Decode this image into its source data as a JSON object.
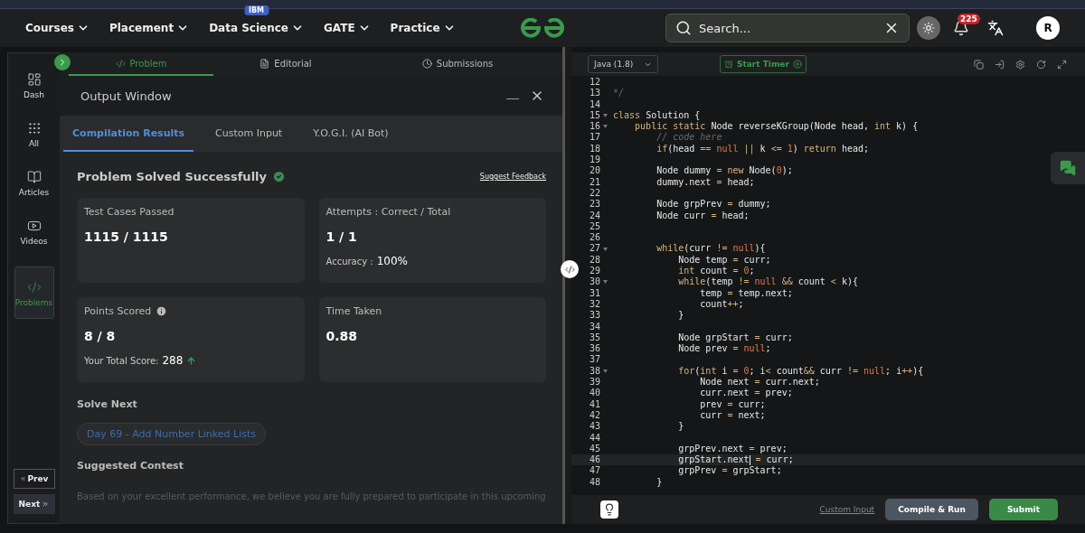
{
  "nav": {
    "items": [
      {
        "label": "Courses"
      },
      {
        "label": "Placement"
      },
      {
        "label": "Data Science",
        "badge": "IBM"
      },
      {
        "label": "GATE"
      },
      {
        "label": "Practice"
      }
    ],
    "search": {
      "placeholder": "Search..."
    },
    "notifications": "225",
    "avatar": "R"
  },
  "sidebar": {
    "items": [
      {
        "label": "Dash",
        "selected": false
      },
      {
        "label": "All",
        "selected": false
      },
      {
        "label": "Articles",
        "selected": false
      },
      {
        "label": "Videos",
        "selected": false
      },
      {
        "label": "Problems",
        "selected": true
      }
    ],
    "prev": "Prev",
    "next": "Next"
  },
  "problem_tabs": [
    {
      "label": "Problem",
      "selected": true
    },
    {
      "label": "Editorial",
      "selected": false
    },
    {
      "label": "Submissions",
      "selected": false
    }
  ],
  "output": {
    "title": "Output Window",
    "tabs": [
      {
        "label": "Compilation Results",
        "selected": true
      },
      {
        "label": "Custom Input",
        "selected": false
      },
      {
        "label": "Y.O.G.I. (AI Bot)",
        "selected": false
      }
    ],
    "status": "Problem Solved Successfully",
    "feedback": "Suggest Feedback",
    "cards": [
      {
        "label": "Test Cases Passed",
        "value": "1115 / 1115"
      },
      {
        "label": "Attempts : Correct / Total",
        "value": "1 / 1",
        "extra_label": "Accuracy :",
        "extra_value": "100%"
      },
      {
        "label": "Points Scored",
        "info": true,
        "value": "8 / 8",
        "extra_label": "Your Total Score:",
        "extra_value": "288",
        "trend_up": true
      },
      {
        "label": "Time Taken",
        "value": "0.88"
      }
    ],
    "solve_next": {
      "heading": "Solve Next",
      "link": "Day 69 - Add Number Linked Lists"
    },
    "contest": {
      "heading": "Suggested Contest",
      "text": "Based on your excellent performance, we believe you are fully prepared to participate in this upcoming"
    }
  },
  "editor": {
    "language": "Java (1.8)",
    "timer": "Start Timer",
    "lines": [
      {
        "n": "12"
      },
      {
        "n": "13",
        "tokens": [
          {
            "kind": "comment",
            "text": "*/"
          }
        ]
      },
      {
        "n": "14"
      },
      {
        "n": "15",
        "fold": true,
        "tokens": [
          {
            "kind": "keyword",
            "text": "class"
          },
          {
            "kind": "plain",
            "text": " Solution {"
          }
        ]
      },
      {
        "n": "16",
        "fold": true,
        "tokens": [
          {
            "kind": "keyword",
            "text": "    public static"
          },
          {
            "kind": "plain",
            "text": " Node reverseKGroup(Node head, "
          },
          {
            "kind": "keyword",
            "text": "int"
          },
          {
            "kind": "plain",
            "text": " k) {"
          }
        ]
      },
      {
        "n": "17",
        "tokens": [
          {
            "kind": "comment",
            "text": "        // code here"
          }
        ]
      },
      {
        "n": "18",
        "tokens": [
          {
            "kind": "keyword",
            "text": "        if"
          },
          {
            "kind": "plain",
            "text": "(head "
          },
          {
            "kind": "operator",
            "text": "== "
          },
          {
            "kind": "literal",
            "text": "null "
          },
          {
            "kind": "operator",
            "text": "|| "
          },
          {
            "kind": "plain",
            "text": "k "
          },
          {
            "kind": "operator",
            "text": "<= "
          },
          {
            "kind": "literal",
            "text": "1"
          },
          {
            "kind": "plain",
            "text": ") "
          },
          {
            "kind": "keyword",
            "text": "return"
          },
          {
            "kind": "plain",
            "text": " head;"
          }
        ]
      },
      {
        "n": "19"
      },
      {
        "n": "20",
        "tokens": [
          {
            "kind": "plain",
            "text": "        Node dummy "
          },
          {
            "kind": "operator",
            "text": "= "
          },
          {
            "kind": "keyword",
            "text": "new"
          },
          {
            "kind": "plain",
            "text": " Node("
          },
          {
            "kind": "literal",
            "text": "0"
          },
          {
            "kind": "plain",
            "text": ");"
          }
        ]
      },
      {
        "n": "21",
        "tokens": [
          {
            "kind": "plain",
            "text": "        dummy.next "
          },
          {
            "kind": "operator",
            "text": "="
          },
          {
            "kind": "plain",
            "text": " head;"
          }
        ]
      },
      {
        "n": "22"
      },
      {
        "n": "23",
        "tokens": [
          {
            "kind": "plain",
            "text": "        Node grpPrev "
          },
          {
            "kind": "operator",
            "text": "="
          },
          {
            "kind": "plain",
            "text": " dummy;"
          }
        ]
      },
      {
        "n": "24",
        "tokens": [
          {
            "kind": "plain",
            "text": "        Node curr "
          },
          {
            "kind": "operator",
            "text": "="
          },
          {
            "kind": "plain",
            "text": " head;"
          }
        ]
      },
      {
        "n": "25"
      },
      {
        "n": "26"
      },
      {
        "n": "27",
        "fold": true,
        "tokens": [
          {
            "kind": "keyword",
            "text": "        while"
          },
          {
            "kind": "plain",
            "text": "(curr "
          },
          {
            "kind": "operator",
            "text": "!= "
          },
          {
            "kind": "literal",
            "text": "null"
          },
          {
            "kind": "plain",
            "text": "){"
          }
        ]
      },
      {
        "n": "28",
        "tokens": [
          {
            "kind": "plain",
            "text": "            Node temp "
          },
          {
            "kind": "operator",
            "text": "="
          },
          {
            "kind": "plain",
            "text": " curr;"
          }
        ]
      },
      {
        "n": "29",
        "tokens": [
          {
            "kind": "keyword",
            "text": "            int"
          },
          {
            "kind": "plain",
            "text": " count "
          },
          {
            "kind": "operator",
            "text": "= "
          },
          {
            "kind": "literal",
            "text": "0"
          },
          {
            "kind": "plain",
            "text": ";"
          }
        ]
      },
      {
        "n": "30",
        "fold": true,
        "tokens": [
          {
            "kind": "keyword",
            "text": "            while"
          },
          {
            "kind": "plain",
            "text": "(temp "
          },
          {
            "kind": "operator",
            "text": "!= "
          },
          {
            "kind": "literal",
            "text": "null "
          },
          {
            "kind": "operator",
            "text": "&&"
          },
          {
            "kind": "plain",
            "text": " count "
          },
          {
            "kind": "operator",
            "text": "<"
          },
          {
            "kind": "plain",
            "text": " k){"
          }
        ]
      },
      {
        "n": "31",
        "tokens": [
          {
            "kind": "plain",
            "text": "                temp "
          },
          {
            "kind": "operator",
            "text": "="
          },
          {
            "kind": "plain",
            "text": " temp.next;"
          }
        ]
      },
      {
        "n": "32",
        "tokens": [
          {
            "kind": "plain",
            "text": "                count"
          },
          {
            "kind": "operator",
            "text": "++"
          },
          {
            "kind": "plain",
            "text": ";"
          }
        ]
      },
      {
        "n": "33",
        "tokens": [
          {
            "kind": "plain",
            "text": "            }"
          }
        ]
      },
      {
        "n": "34"
      },
      {
        "n": "35",
        "tokens": [
          {
            "kind": "plain",
            "text": "            Node grpStart "
          },
          {
            "kind": "operator",
            "text": "="
          },
          {
            "kind": "plain",
            "text": " curr;"
          }
        ]
      },
      {
        "n": "36",
        "tokens": [
          {
            "kind": "plain",
            "text": "            Node prev "
          },
          {
            "kind": "operator",
            "text": "= "
          },
          {
            "kind": "literal",
            "text": "null"
          },
          {
            "kind": "plain",
            "text": ";"
          }
        ]
      },
      {
        "n": "37"
      },
      {
        "n": "38",
        "fold": true,
        "tokens": [
          {
            "kind": "keyword",
            "text": "            for"
          },
          {
            "kind": "plain",
            "text": "("
          },
          {
            "kind": "keyword",
            "text": "int"
          },
          {
            "kind": "plain",
            "text": " i "
          },
          {
            "kind": "operator",
            "text": "= "
          },
          {
            "kind": "literal",
            "text": "0"
          },
          {
            "kind": "plain",
            "text": "; i"
          },
          {
            "kind": "operator",
            "text": "<"
          },
          {
            "kind": "plain",
            "text": " count"
          },
          {
            "kind": "operator",
            "text": "&&"
          },
          {
            "kind": "plain",
            "text": " curr "
          },
          {
            "kind": "operator",
            "text": "!= "
          },
          {
            "kind": "literal",
            "text": "null"
          },
          {
            "kind": "plain",
            "text": "; i"
          },
          {
            "kind": "operator",
            "text": "++"
          },
          {
            "kind": "plain",
            "text": "){"
          }
        ]
      },
      {
        "n": "39",
        "tokens": [
          {
            "kind": "plain",
            "text": "                Node next "
          },
          {
            "kind": "operator",
            "text": "="
          },
          {
            "kind": "plain",
            "text": " curr.next;"
          }
        ]
      },
      {
        "n": "40",
        "tokens": [
          {
            "kind": "plain",
            "text": "                curr.next "
          },
          {
            "kind": "operator",
            "text": "="
          },
          {
            "kind": "plain",
            "text": " prev;"
          }
        ]
      },
      {
        "n": "41",
        "tokens": [
          {
            "kind": "plain",
            "text": "                prev "
          },
          {
            "kind": "operator",
            "text": "="
          },
          {
            "kind": "plain",
            "text": " curr;"
          }
        ]
      },
      {
        "n": "42",
        "tokens": [
          {
            "kind": "plain",
            "text": "                curr "
          },
          {
            "kind": "operator",
            "text": "="
          },
          {
            "kind": "plain",
            "text": " next;"
          }
        ]
      },
      {
        "n": "43",
        "tokens": [
          {
            "kind": "plain",
            "text": "            }"
          }
        ]
      },
      {
        "n": "44"
      },
      {
        "n": "45",
        "tokens": [
          {
            "kind": "plain",
            "text": "            grpPrev.next "
          },
          {
            "kind": "operator",
            "text": "="
          },
          {
            "kind": "plain",
            "text": " prev;"
          }
        ]
      },
      {
        "n": "46",
        "current": true,
        "tokens": [
          {
            "kind": "plain",
            "text": "            grpStart.next"
          },
          {
            "kind": "operator",
            "text": " ="
          },
          {
            "kind": "plain",
            "text": " curr;"
          }
        ]
      },
      {
        "n": "47",
        "tokens": [
          {
            "kind": "plain",
            "text": "            grpPrev "
          },
          {
            "kind": "operator",
            "text": "="
          },
          {
            "kind": "plain",
            "text": " grpStart;"
          }
        ]
      },
      {
        "n": "48",
        "tokens": [
          {
            "kind": "plain",
            "text": "        }"
          }
        ]
      }
    ],
    "custom_input": "Custom Input",
    "compile": "Compile & Run",
    "submit": "Submit"
  }
}
